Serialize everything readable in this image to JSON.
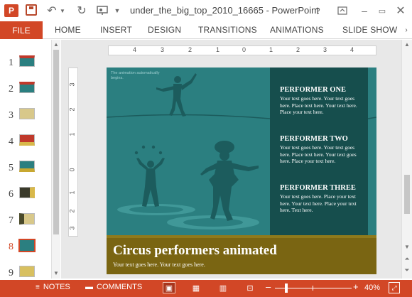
{
  "titlebar": {
    "app_logo": "P",
    "undo_icon": "↶",
    "redo_icon": "↻",
    "doc_title": "under_the_big_top_2010_16665 - PowerPoint",
    "help": "?",
    "minimize": "–",
    "restore": "▭",
    "close": "✕"
  },
  "ribbon": {
    "tabs": [
      "FILE",
      "HOME",
      "INSERT",
      "DESIGN",
      "TRANSITIONS",
      "ANIMATIONS",
      "SLIDE SHOW"
    ],
    "scroll_icon": "›"
  },
  "thumbnails": {
    "numbers": [
      "1",
      "2",
      "3",
      "4",
      "5",
      "6",
      "7",
      "8",
      "9"
    ],
    "active": "8"
  },
  "rulers": {
    "horizontal": [
      "4",
      "3",
      "2",
      "1",
      "0",
      "1",
      "2",
      "3",
      "4"
    ],
    "vertical": [
      "3",
      "2",
      "1",
      "0",
      "1",
      "2",
      "3"
    ]
  },
  "slide": {
    "animation_note": "The animation automatically begins.",
    "performers": [
      {
        "title": "PERFORMER ONE",
        "text": "Your text goes here. Your text goes here. Place text here. Your text here. Place your text here."
      },
      {
        "title": "PERFORMER TWO",
        "text": "Your text goes here. Your text goes here. Place text here. Your text goes here. Place your text here."
      },
      {
        "title": "PERFORMER THREE",
        "text": "Your text goes here. Place your text here. Your text here. Place your text here. Text here."
      }
    ],
    "title": "Circus performers animated",
    "subtitle": "Your text goes here. Your text goes here.",
    "colors": {
      "background": "#2b7f80",
      "panel": "#164e4d",
      "band": "#7a6512",
      "silhouette": "#1c5c5d",
      "ring": "#4aa3a3"
    }
  },
  "statusbar": {
    "notes": "NOTES",
    "comments": "COMMENTS",
    "zoom_minus": "–",
    "zoom_plus": "+",
    "zoom": "40%",
    "color": "#d24726"
  }
}
